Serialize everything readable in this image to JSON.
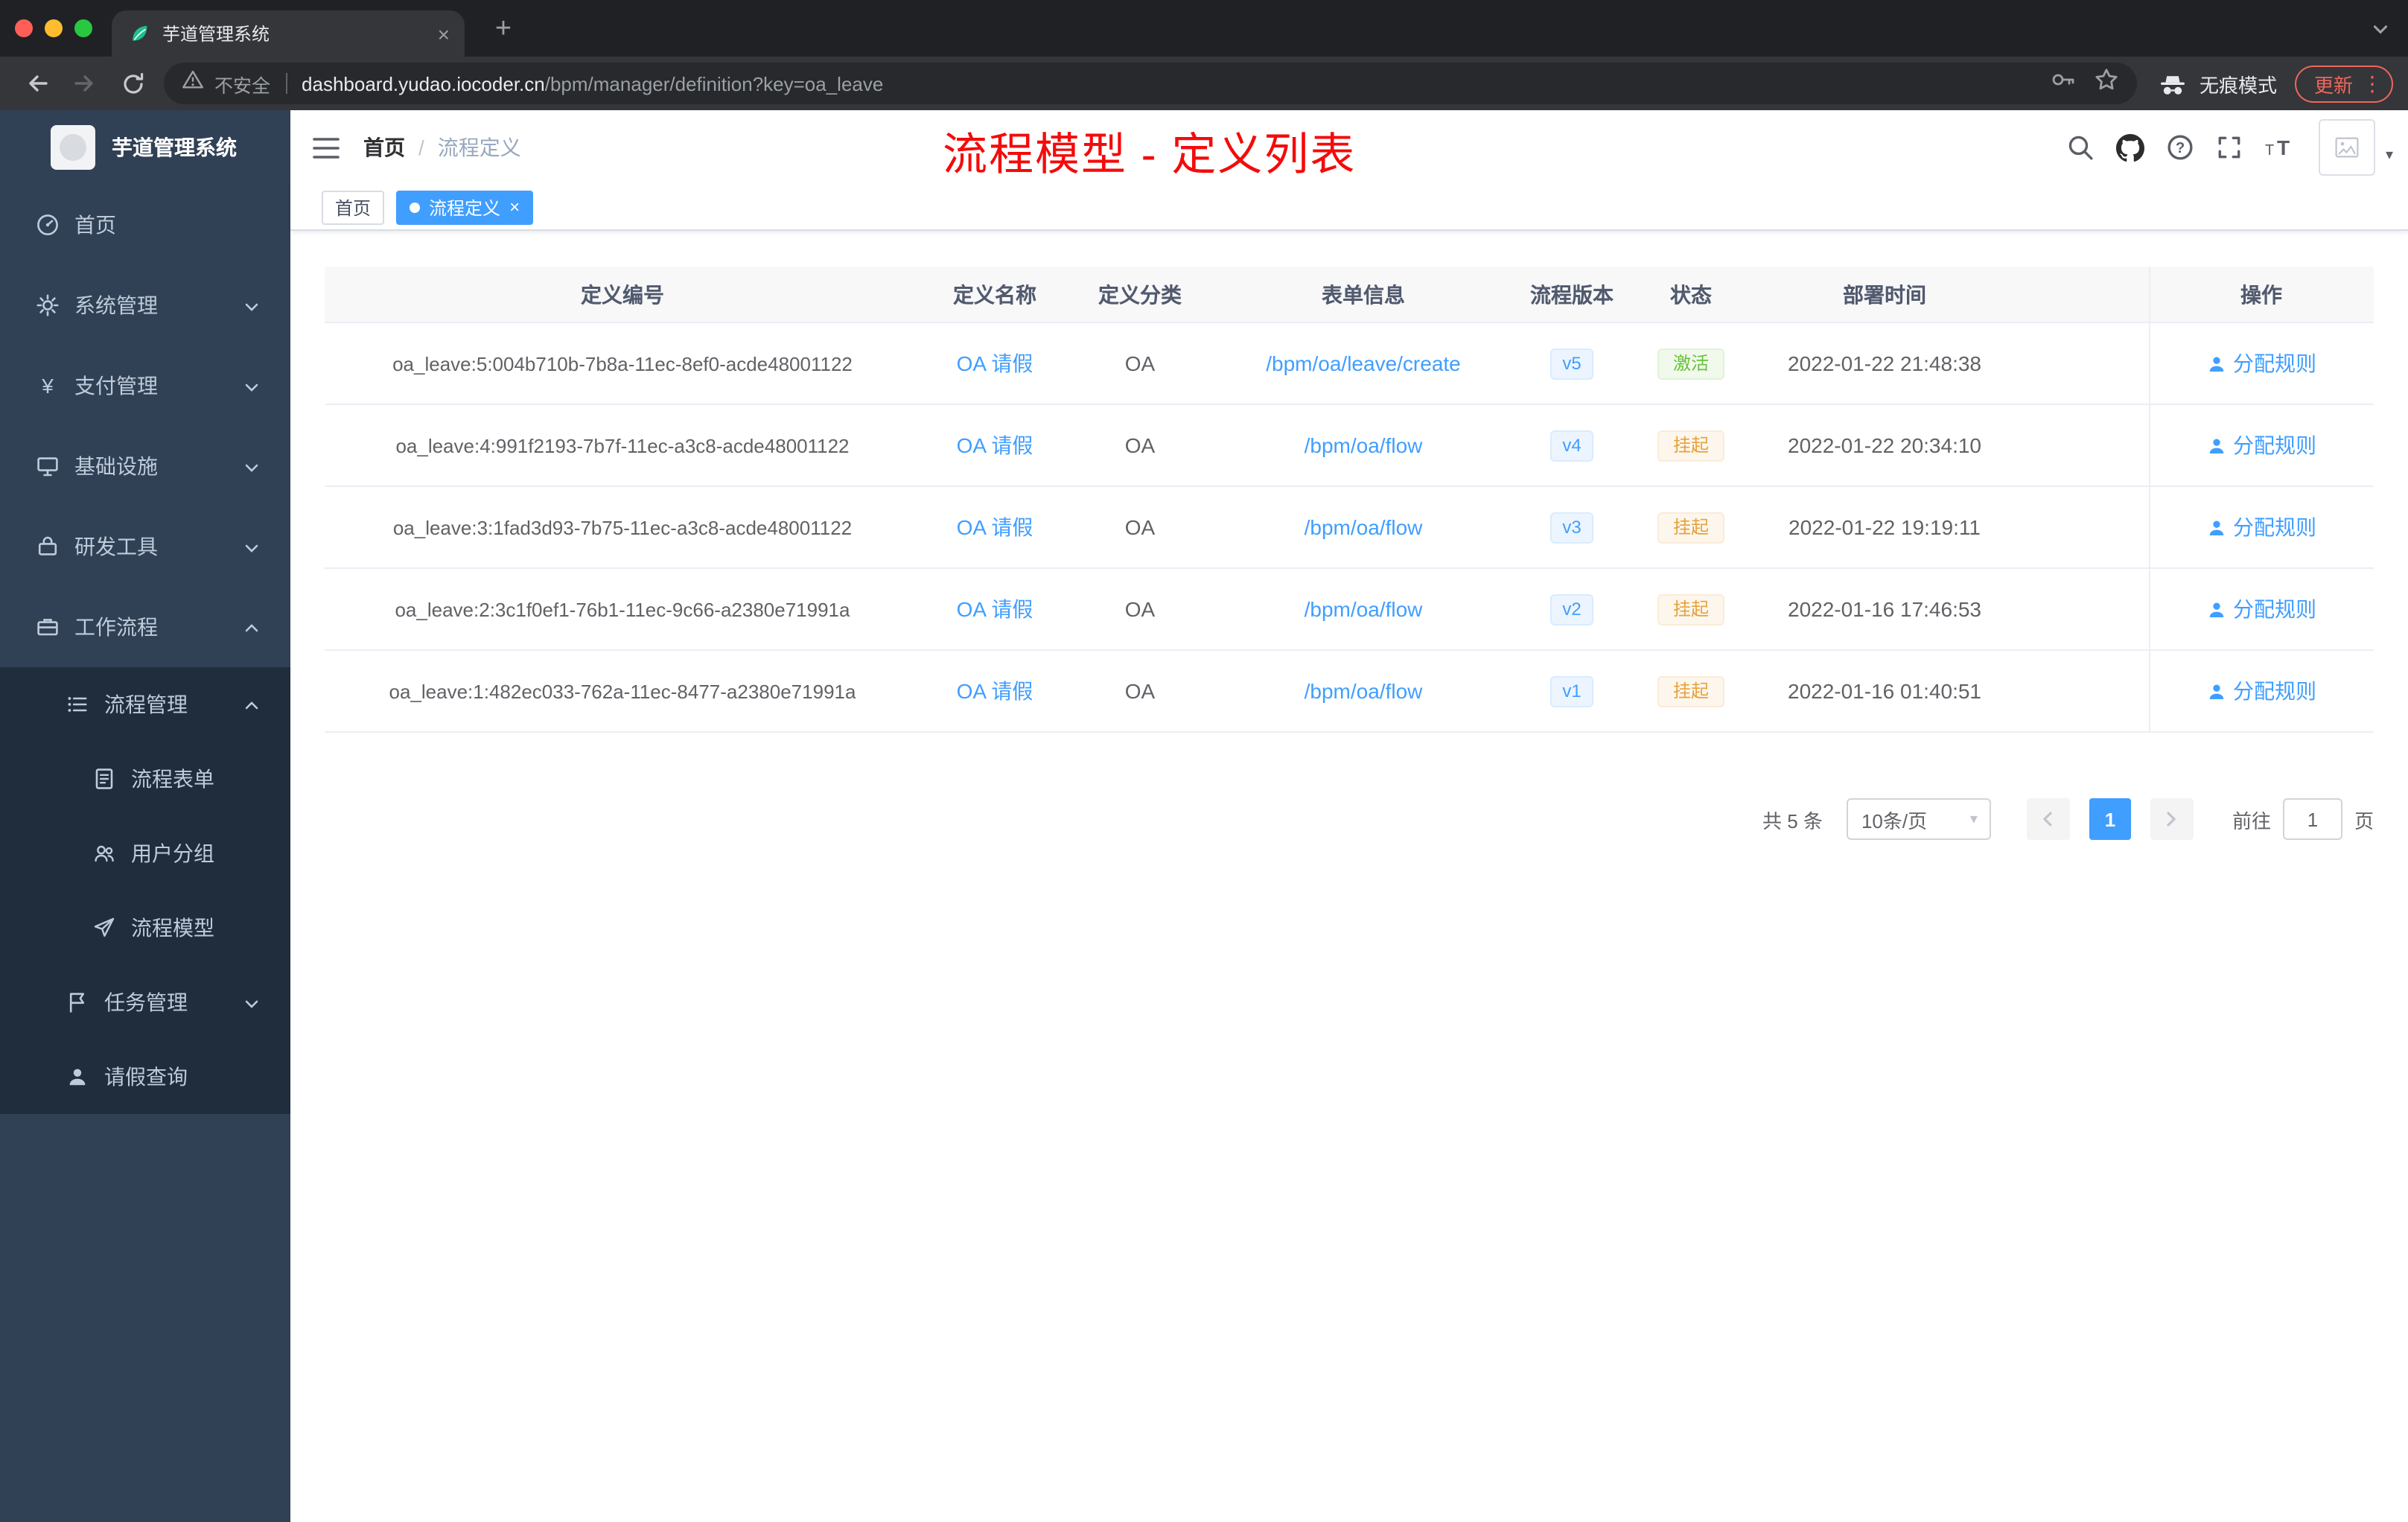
{
  "colors": {
    "accent": "#409eff",
    "sidebar_bg": "#304156",
    "submenu_bg": "#1f2d3d",
    "success": "#67c23a",
    "warning": "#e6a23c",
    "annotation_red": "#f40b0b",
    "update_pill": "#ee675c"
  },
  "icons": {
    "close": "×",
    "plus": "+",
    "more_vertical": "⋮",
    "caret_down": "▾",
    "yen": "¥"
  },
  "browser": {
    "tab_title": "芋道管理系统",
    "security_label": "不安全",
    "url_host": "dashboard.yudao.iocoder.cn",
    "url_path": "/bpm/manager/definition?key=oa_leave",
    "incognito_label": "无痕模式",
    "update_label": "更新"
  },
  "sidebar": {
    "logo_title": "芋道管理系统",
    "items": [
      {
        "label": "首页"
      },
      {
        "label": "系统管理"
      },
      {
        "label": "支付管理"
      },
      {
        "label": "基础设施"
      },
      {
        "label": "研发工具"
      },
      {
        "label": "工作流程"
      },
      {
        "label": "流程管理"
      },
      {
        "label": "流程表单"
      },
      {
        "label": "用户分组"
      },
      {
        "label": "流程模型"
      },
      {
        "label": "任务管理"
      },
      {
        "label": "请假查询"
      }
    ]
  },
  "header": {
    "breadcrumb_home": "首页",
    "breadcrumb_separator": "/",
    "breadcrumb_current": "流程定义",
    "annotation": "流程模型 - 定义列表"
  },
  "tags": {
    "items": [
      {
        "label": "首页"
      },
      {
        "label": "流程定义"
      }
    ]
  },
  "table": {
    "columns": [
      "定义编号",
      "定义名称",
      "定义分类",
      "表单信息",
      "流程版本",
      "状态",
      "部署时间",
      "操作"
    ],
    "rows": [
      {
        "id": "oa_leave:5:004b710b-7b8a-11ec-8ef0-acde48001122",
        "name": "OA 请假",
        "category": "OA",
        "form": "/bpm/oa/leave/create",
        "version": "v5",
        "status": "激活",
        "status_type": "success",
        "deployed": "2022-01-22 21:48:38",
        "action": "分配规则"
      },
      {
        "id": "oa_leave:4:991f2193-7b7f-11ec-a3c8-acde48001122",
        "name": "OA 请假",
        "category": "OA",
        "form": "/bpm/oa/flow",
        "version": "v4",
        "status": "挂起",
        "status_type": "warning",
        "deployed": "2022-01-22 20:34:10",
        "action": "分配规则"
      },
      {
        "id": "oa_leave:3:1fad3d93-7b75-11ec-a3c8-acde48001122",
        "name": "OA 请假",
        "category": "OA",
        "form": "/bpm/oa/flow",
        "version": "v3",
        "status": "挂起",
        "status_type": "warning",
        "deployed": "2022-01-22 19:19:11",
        "action": "分配规则"
      },
      {
        "id": "oa_leave:2:3c1f0ef1-76b1-11ec-9c66-a2380e71991a",
        "name": "OA 请假",
        "category": "OA",
        "form": "/bpm/oa/flow",
        "version": "v2",
        "status": "挂起",
        "status_type": "warning",
        "deployed": "2022-01-16 17:46:53",
        "action": "分配规则"
      },
      {
        "id": "oa_leave:1:482ec033-762a-11ec-8477-a2380e71991a",
        "name": "OA 请假",
        "category": "OA",
        "form": "/bpm/oa/flow",
        "version": "v1",
        "status": "挂起",
        "status_type": "warning",
        "deployed": "2022-01-16 01:40:51",
        "action": "分配规则"
      }
    ]
  },
  "pagination": {
    "total_label": "共 5 条",
    "page_size": "10条/页",
    "current_page": "1",
    "goto_label": "前往",
    "goto_value": "1",
    "page_unit": "页"
  }
}
